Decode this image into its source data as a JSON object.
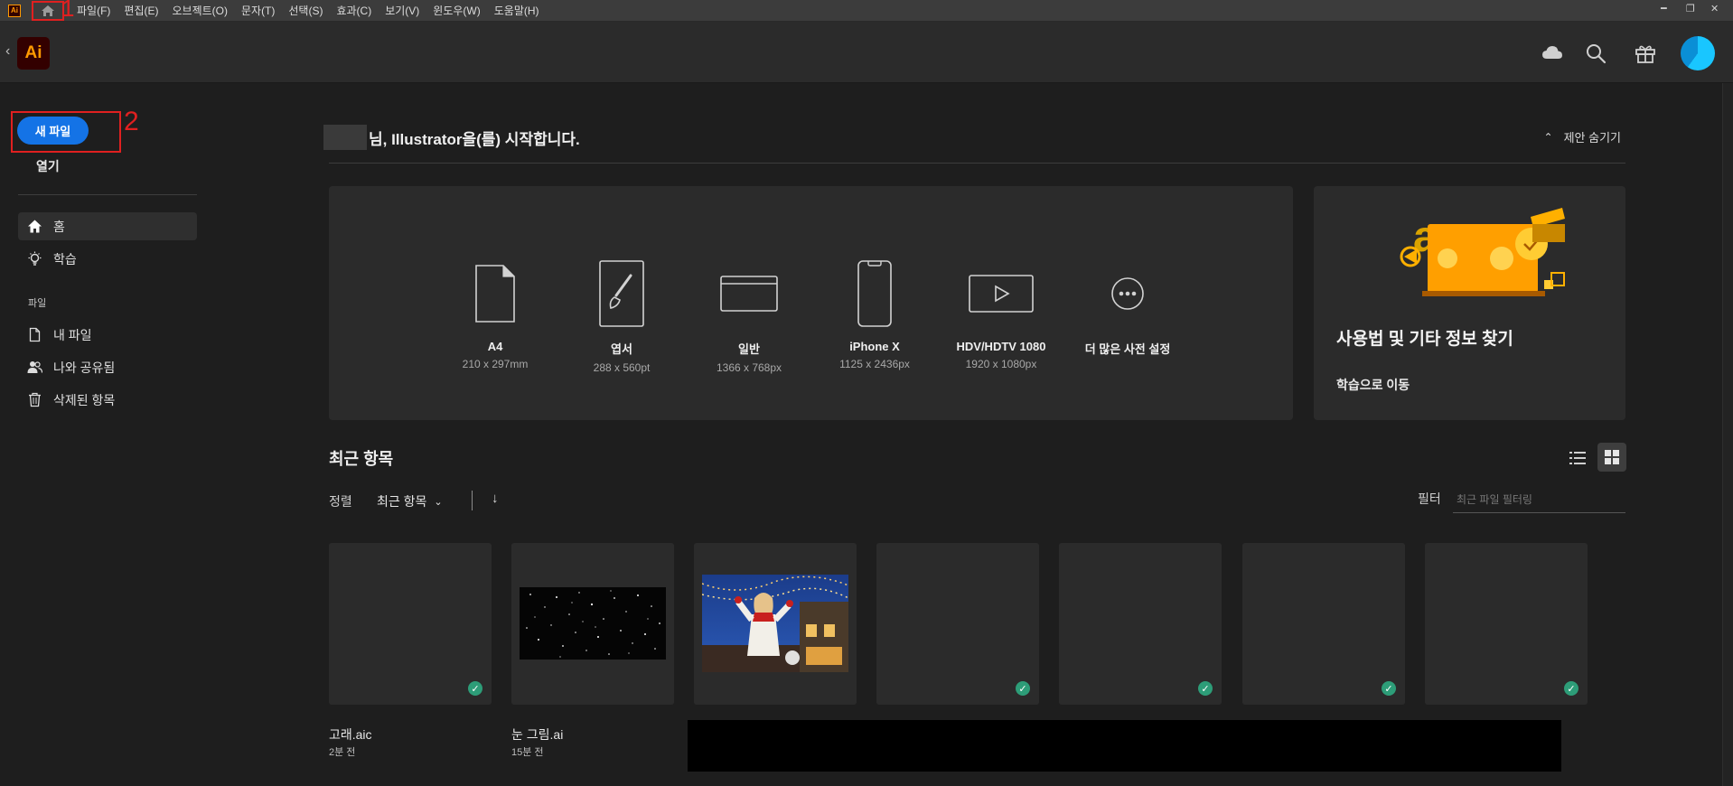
{
  "menubar": {
    "items": [
      "파일(F)",
      "편집(E)",
      "오브젝트(O)",
      "문자(T)",
      "선택(S)",
      "효과(C)",
      "보기(V)",
      "윈도우(W)",
      "도움말(H)"
    ],
    "app_mini": "Ai",
    "win_min": "━",
    "win_restore": "❐",
    "win_close": "✕"
  },
  "annotations": {
    "one": "1",
    "two": "2"
  },
  "header": {
    "logo": "Ai",
    "back": "‹"
  },
  "sidebar": {
    "new_file": "새 파일",
    "open": "열기",
    "items": [
      {
        "label": "홈",
        "icon": "home-icon"
      },
      {
        "label": "학습",
        "icon": "lightbulb-icon"
      }
    ],
    "section_label": "파일",
    "file_items": [
      {
        "label": "내 파일",
        "icon": "file-icon"
      },
      {
        "label": "나와 공유됨",
        "icon": "shared-users-icon"
      },
      {
        "label": "삭제된 항목",
        "icon": "trash-icon"
      }
    ]
  },
  "welcome": {
    "text": "님, Illustrator을(를) 시작합니다.",
    "hide_suggestions": "제안 숨기기",
    "hide_caret": "⌃"
  },
  "presets": [
    {
      "name": "A4",
      "size": "210 x 297mm",
      "icon": "document-icon"
    },
    {
      "name": "엽서",
      "size": "288 x 560pt",
      "icon": "brush-card-icon"
    },
    {
      "name": "일반",
      "size": "1366 x 768px",
      "icon": "browser-window-icon"
    },
    {
      "name": "iPhone X",
      "size": "1125 x 2436px",
      "icon": "phone-icon"
    },
    {
      "name": "HDV/HDTV 1080",
      "size": "1920 x 1080px",
      "icon": "video-play-icon"
    },
    {
      "name": "더 많은 사전 설정",
      "size": "",
      "icon": "more-icon"
    }
  ],
  "learn_card": {
    "title": "사용법 및 기타 정보 찾기",
    "link": "학습으로 이동"
  },
  "recent": {
    "title": "최근 항목",
    "sort_label": "정렬",
    "sort_value": "최근 항목",
    "sort_chev": "⌄",
    "sort_dir": "↓",
    "filter_label": "필터",
    "filter_placeholder": "최근 파일 필터링",
    "files": [
      {
        "name": "고래.aic",
        "time": "2분 전",
        "synced": true,
        "art": "blank"
      },
      {
        "name": "눈 그림.ai",
        "time": "15분 전",
        "synced": false,
        "art": "snow"
      },
      {
        "name": "",
        "time": "",
        "synced": false,
        "art": "photo"
      },
      {
        "name": "",
        "time": "",
        "synced": true,
        "art": "blank"
      },
      {
        "name": "",
        "time": "",
        "synced": true,
        "art": "blank"
      },
      {
        "name": "",
        "time": "",
        "synced": true,
        "art": "blank"
      },
      {
        "name": "",
        "time": "",
        "synced": true,
        "art": "blank"
      }
    ],
    "check": "✓"
  }
}
